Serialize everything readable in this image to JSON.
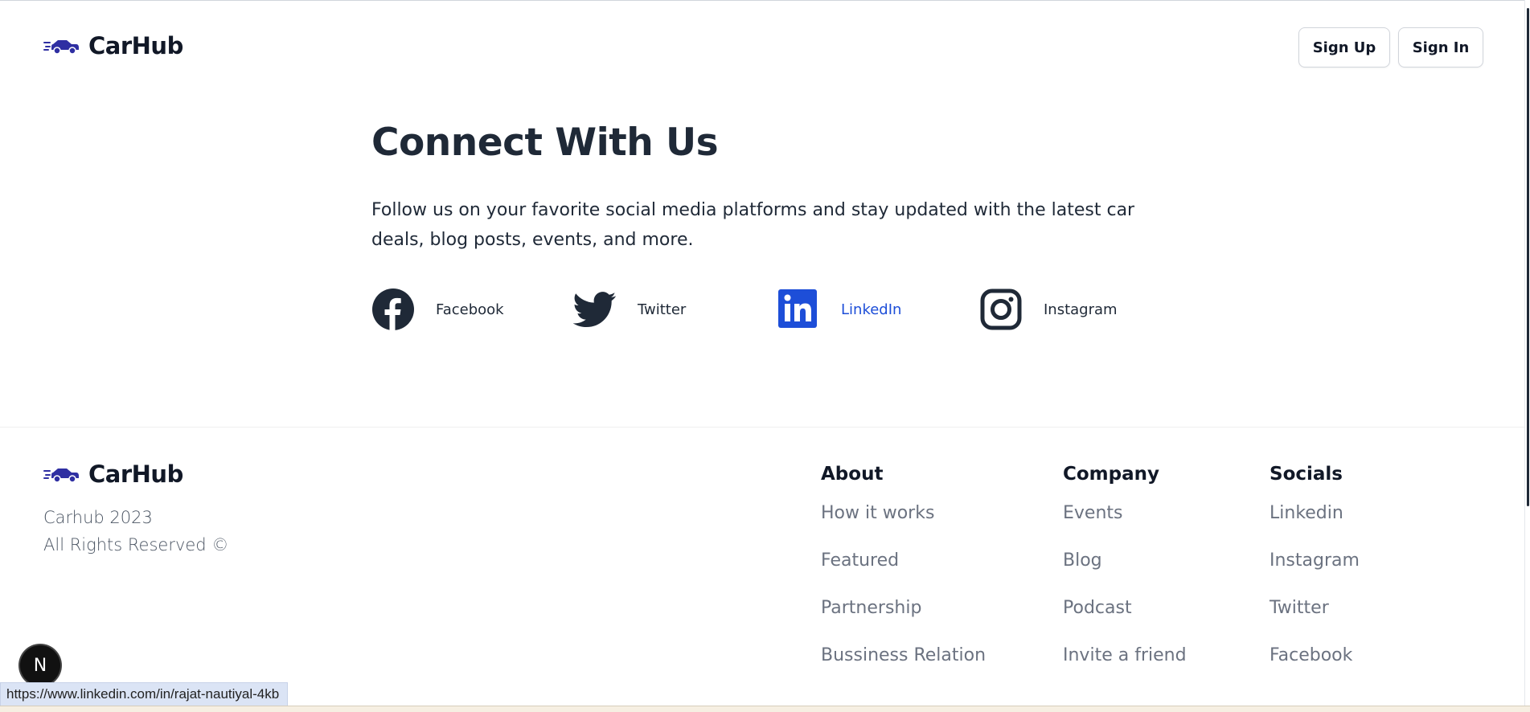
{
  "header": {
    "brand": "CarHub",
    "sign_up": "Sign Up",
    "sign_in": "Sign In",
    "icon": "car-icon"
  },
  "connect": {
    "title": "Connect With Us",
    "description": "Follow us on your favorite social media platforms and stay updated with the latest car deals, blog posts, events, and more.",
    "socials": [
      {
        "label": "Facebook",
        "icon": "facebook-icon"
      },
      {
        "label": "Twitter",
        "icon": "twitter-icon"
      },
      {
        "label": "LinkedIn",
        "icon": "linkedin-icon",
        "hovered": true
      },
      {
        "label": "Instagram",
        "icon": "instagram-icon"
      }
    ]
  },
  "footer": {
    "brand": "CarHub",
    "copyright_line1": "Carhub 2023",
    "copyright_line2": "All Rights Reserved ©",
    "columns": [
      {
        "title": "About",
        "links": [
          "How it works",
          "Featured",
          "Partnership",
          "Bussiness Relation"
        ]
      },
      {
        "title": "Company",
        "links": [
          "Events",
          "Blog",
          "Podcast",
          "Invite a friend"
        ]
      },
      {
        "title": "Socials",
        "links": [
          "Linkedin",
          "Instagram",
          "Twitter",
          "Facebook"
        ]
      }
    ]
  },
  "nextjs_badge": "N",
  "status_bar_url": "https://www.linkedin.com/in/rajat-nautiyal-4kb",
  "colors": {
    "brand_icon": "#2f2fa2",
    "text_dark": "#1f2937",
    "link_hover": "#1d4ed8",
    "linkedin_blue": "#0a66c2",
    "footer_link": "#6b7280"
  }
}
